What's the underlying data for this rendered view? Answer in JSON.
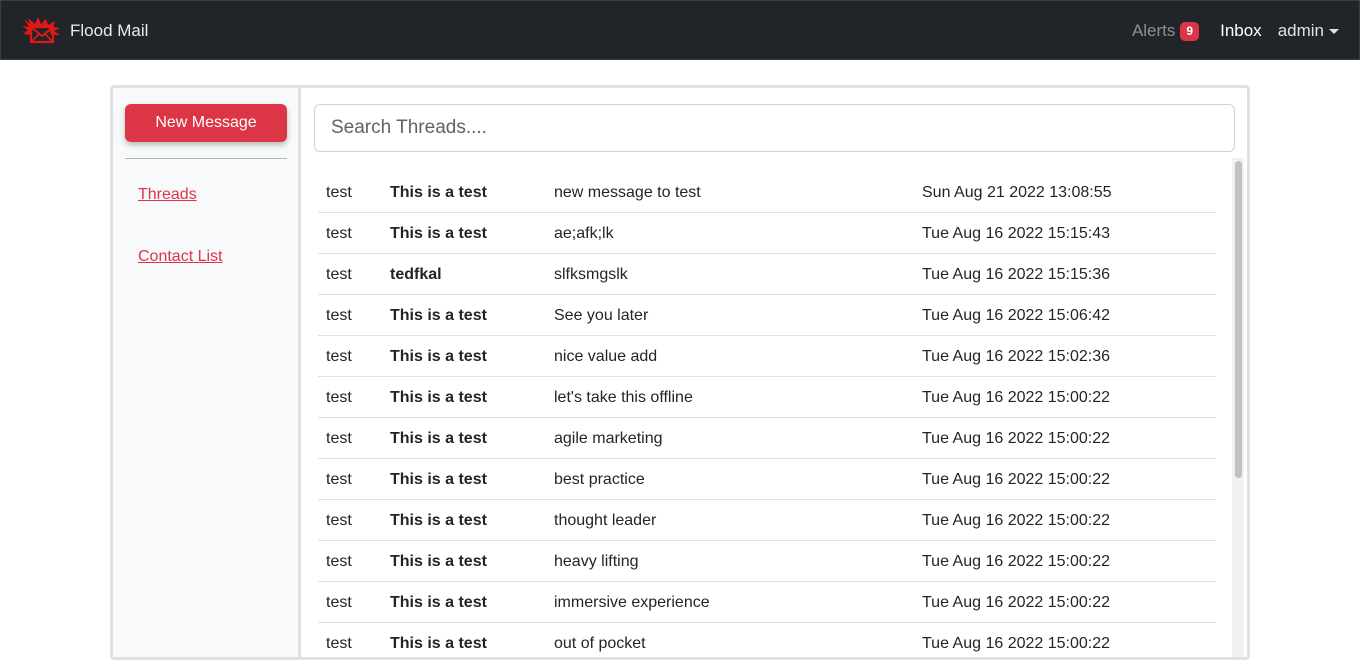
{
  "navbar": {
    "brand_icon": "envelope-flame-logo-icon",
    "brand_name": "Flood Mail",
    "alerts_label": "Alerts",
    "alerts_count": "9",
    "inbox_label": "Inbox",
    "user_label": "admin"
  },
  "colors": {
    "accent": "#dc3545",
    "navbar_bg": "#212529"
  },
  "sidebar": {
    "new_message_label": "New Message",
    "links": [
      {
        "label": "Threads"
      },
      {
        "label": "Contact List"
      }
    ]
  },
  "search": {
    "placeholder": "Search Threads...."
  },
  "threads": [
    {
      "from": "test",
      "subject": "This is a test",
      "preview": "new message to test",
      "date": "Sun Aug 21 2022 13:08:55"
    },
    {
      "from": "test",
      "subject": "This is a test",
      "preview": "ae;afk;lk",
      "date": "Tue Aug 16 2022 15:15:43"
    },
    {
      "from": "test",
      "subject": "tedfkal",
      "preview": "slfksmgslk",
      "date": "Tue Aug 16 2022 15:15:36"
    },
    {
      "from": "test",
      "subject": "This is a test",
      "preview": "See you later",
      "date": "Tue Aug 16 2022 15:06:42"
    },
    {
      "from": "test",
      "subject": "This is a test",
      "preview": "nice value add",
      "date": "Tue Aug 16 2022 15:02:36"
    },
    {
      "from": "test",
      "subject": "This is a test",
      "preview": "let's take this offline",
      "date": "Tue Aug 16 2022 15:00:22"
    },
    {
      "from": "test",
      "subject": "This is a test",
      "preview": "agile marketing",
      "date": "Tue Aug 16 2022 15:00:22"
    },
    {
      "from": "test",
      "subject": "This is a test",
      "preview": "best practice",
      "date": "Tue Aug 16 2022 15:00:22"
    },
    {
      "from": "test",
      "subject": "This is a test",
      "preview": "thought leader",
      "date": "Tue Aug 16 2022 15:00:22"
    },
    {
      "from": "test",
      "subject": "This is a test",
      "preview": "heavy lifting",
      "date": "Tue Aug 16 2022 15:00:22"
    },
    {
      "from": "test",
      "subject": "This is a test",
      "preview": "immersive experience",
      "date": "Tue Aug 16 2022 15:00:22"
    },
    {
      "from": "test",
      "subject": "This is a test",
      "preview": "out of pocket",
      "date": "Tue Aug 16 2022 15:00:22"
    }
  ]
}
